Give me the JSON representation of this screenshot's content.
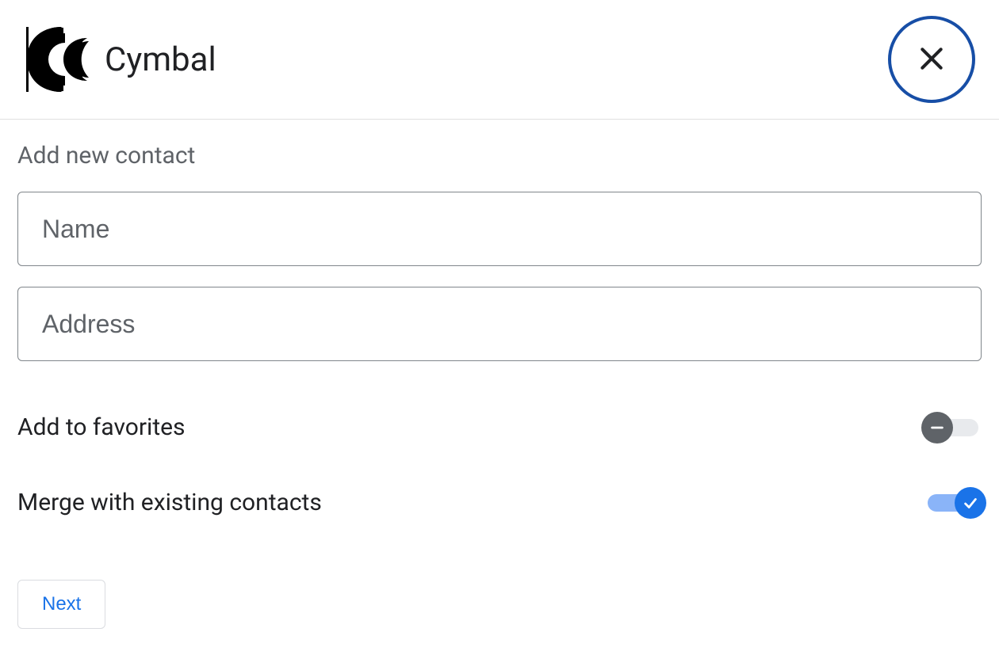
{
  "header": {
    "app_title": "Cymbal"
  },
  "form": {
    "section_title": "Add new contact",
    "name_placeholder": "Name",
    "name_value": "",
    "address_placeholder": "Address",
    "address_value": "",
    "favorites_label": "Add to favorites",
    "favorites_on": false,
    "merge_label": "Merge with existing contacts",
    "merge_on": true,
    "next_label": "Next"
  }
}
